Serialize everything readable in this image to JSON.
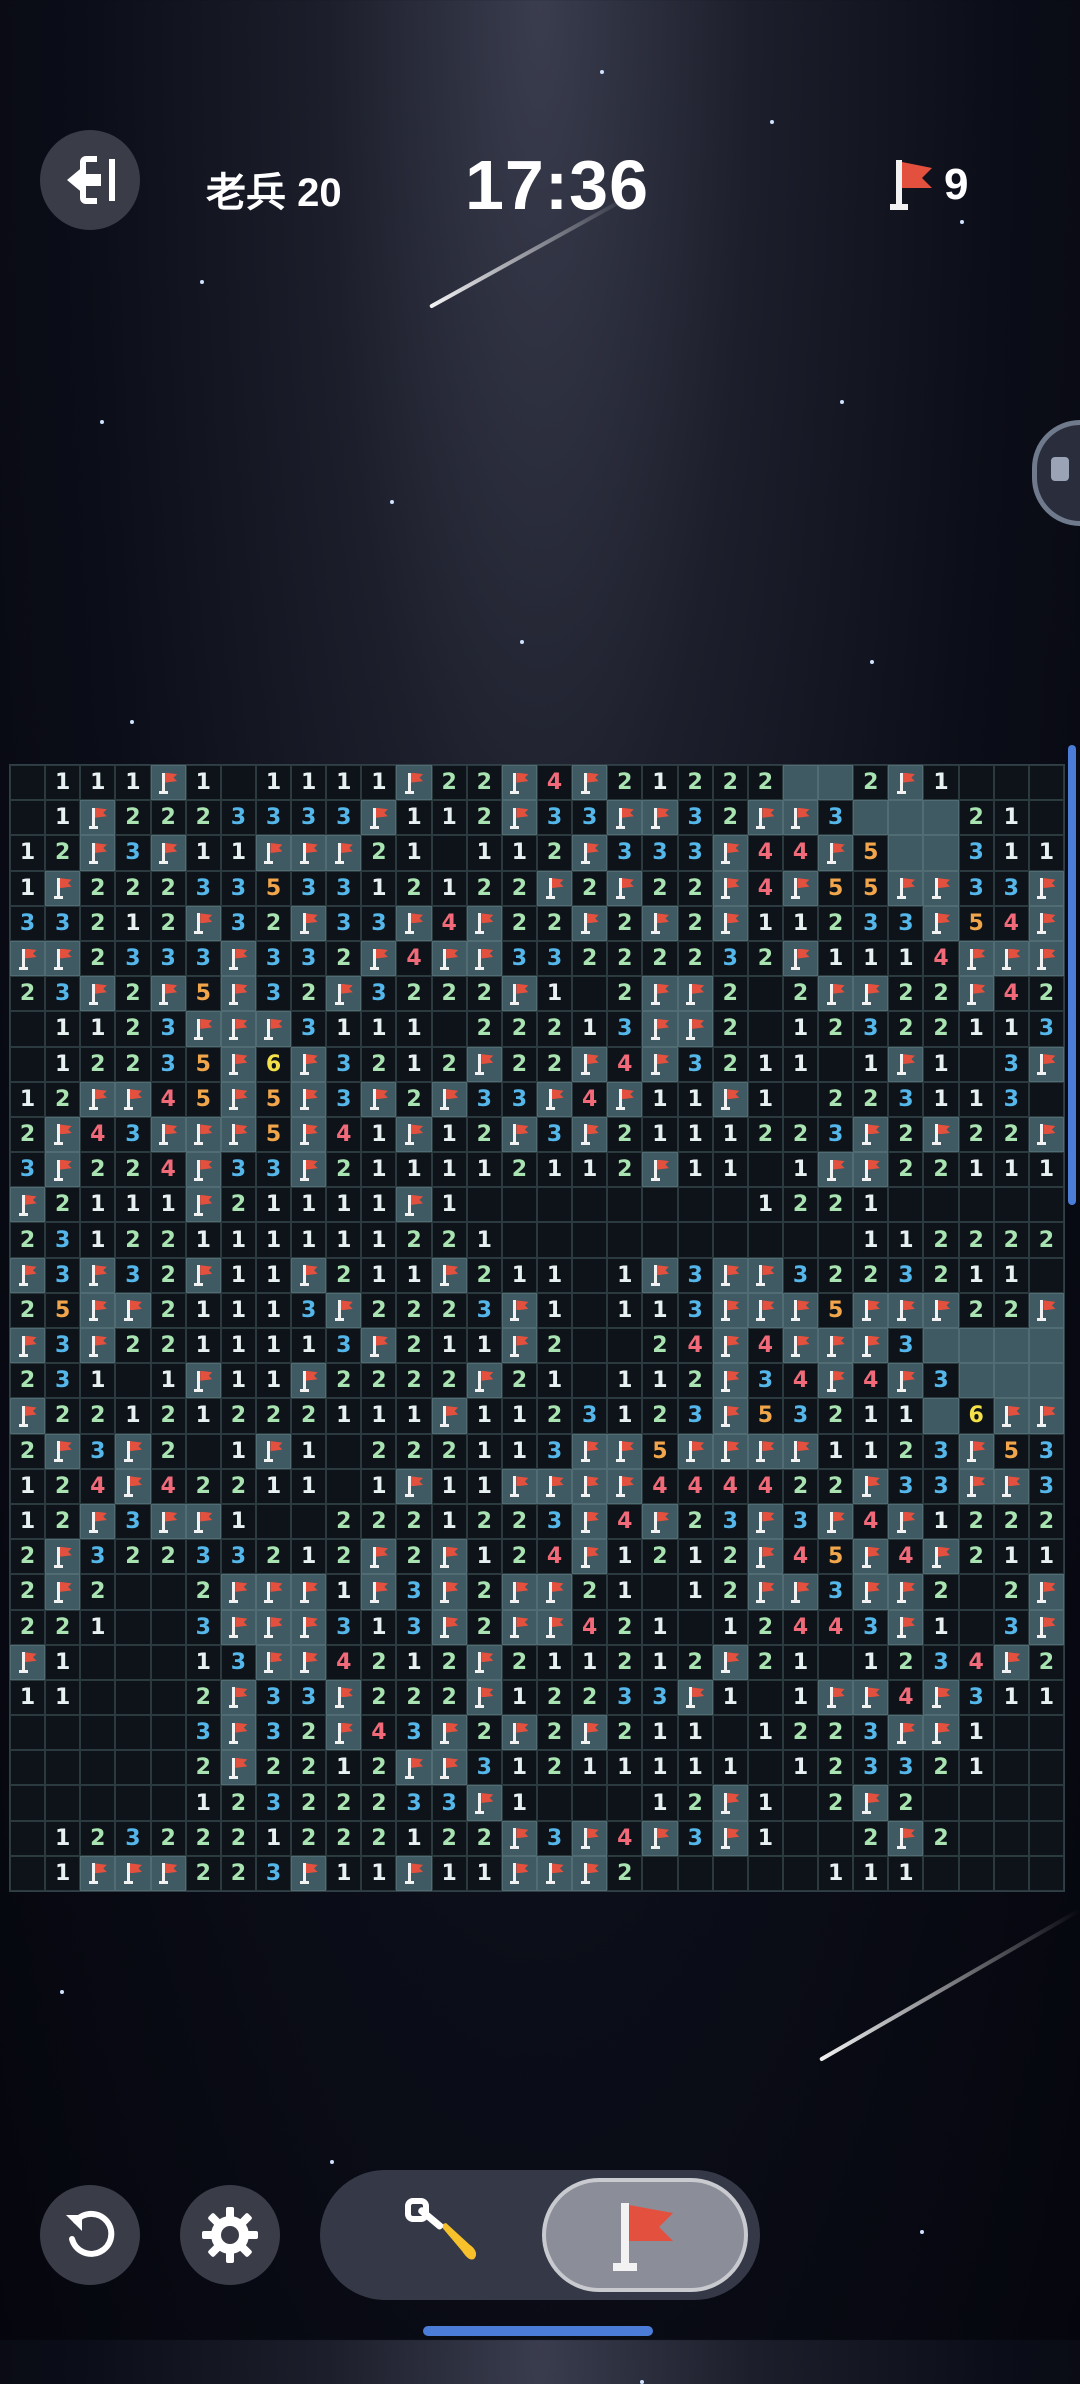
{
  "header": {
    "rank_label": "老兵 20",
    "timer": "17:36",
    "flags_remaining": "9"
  },
  "board": {
    "cols": 30,
    "rows": 32,
    "legend": "digits = revealed number, F = flagged, U = unrevealed, . = empty revealed",
    "grid": [
      ".111F1.1111F22F4F21222UU2F1..",
      ".1F2223333F112F33FF32FF3UUU21.",
      "12F3F11FFF21.112F333F44F5UU3111",
      "1F2223353312122F2F22F4F55FF33F",
      "33212F32F33F4F22F2F2F11233F54F",
      "FF2333F332F4FF33222232F1114FFF",
      "23F2F5F32F3222F1.2FF2.2FF22F42",
      ".1123FFF3111.22213FF2.12322113",
      ".12235F6F3212F22F4F3211.1F1.3F",
      "12FF45F5F3F2F33F4F11F1.223113",
      "2F43FFF5F41F12F3F2111223F2F22F",
      "3F224F33F211112112F11.1FF22111",
      "F2111F21111F1........1221.....",
      "23122111111221..........1122221",
      "F3F32F11F211F211.1F3FF3223211",
      "25FF21113F2223F1.113FFF5FFF22F",
      "F3F2211113F211F2..24F4FFF3UUUUU",
      "231.1F11F2222F21.112F34F4F3UUU",
      "F22121222111F1123123F53211U6FF",
      "2F3F2.1F1.222113FF5FFFF1123F53",
      "124F42211.1F11FFFF444422F33FF3",
      "12F3FF1..2221223F4F23F3F4F12221",
      "2F32233212F2F124F1212F45F4F2111",
      "2F2..2FFF1F3F2FF21.12FF3FF2.2F2",
      "221..3FFF313F2FF421.12443F1.3F2",
      "F1...13FF4212F211212F21.1234F21",
      "11...2F33F222F12233F1.1FF4F3111",
      ".....3F32F43F2F2F211.1223FF1...",
      ".....2F2212FF31211111.123321...",
      ".....12322233F1...12F1.2F2....",
      ".1232221222122F3F4F3F1..2F2...",
      ".1FFF223F11F11FFF2.....111...."
    ]
  },
  "controls": {
    "undo_icon": "undo-icon",
    "settings_icon": "gear-icon",
    "dig_icon": "shovel-icon",
    "flag_icon": "flag-icon",
    "active_mode": "flag"
  },
  "colors": {
    "n1": "#e8f1f2",
    "n2": "#a9e3b1",
    "n3": "#55b6ea",
    "n4": "#f06a7a",
    "n5": "#f2a64b",
    "n6": "#f4e14a",
    "flag": "#e4503e"
  }
}
